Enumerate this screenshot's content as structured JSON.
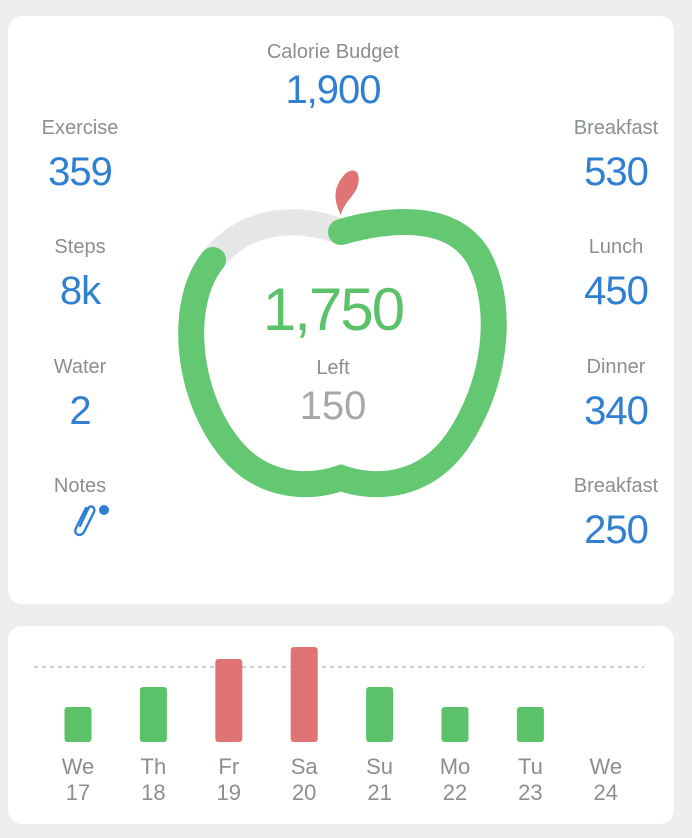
{
  "budget": {
    "label": "Calorie Budget",
    "value": "1,900"
  },
  "left_stats": [
    {
      "label": "Exercise",
      "value": "359"
    },
    {
      "label": "Steps",
      "value": "8k"
    },
    {
      "label": "Water",
      "value": "2"
    },
    {
      "label": "Notes",
      "icon": "paperclip-icon"
    }
  ],
  "right_stats": [
    {
      "label": "Breakfast",
      "value": "530"
    },
    {
      "label": "Lunch",
      "value": "450"
    },
    {
      "label": "Dinner",
      "value": "340"
    },
    {
      "label": "Breakfast",
      "value": "250"
    }
  ],
  "center": {
    "left_value": "1,750",
    "left_label": "Left",
    "secondary_value": "150"
  },
  "progress_ring": {
    "fraction_consumed": 0.85
  },
  "colors": {
    "accent_blue": "#2f7fd2",
    "green": "#5cc26a",
    "green_light": "#6ccf78",
    "red": "#e07474",
    "track_gray": "#e6e6e6",
    "label_gray": "#8a8f94"
  },
  "chart_data": {
    "type": "bar",
    "categories": [
      "We 17",
      "Th 18",
      "Fr 19",
      "Sa 20",
      "Su 21",
      "Mo 22",
      "Tu 23",
      "We 24"
    ],
    "day_names": [
      "We",
      "Th",
      "Fr",
      "Sa",
      "Su",
      "Mo",
      "Tu",
      "We"
    ],
    "day_numbers": [
      "17",
      "18",
      "19",
      "20",
      "21",
      "22",
      "23",
      "24"
    ],
    "values": [
      0.35,
      0.55,
      0.83,
      0.95,
      0.55,
      0.35,
      0.35,
      0
    ],
    "over_budget": [
      false,
      false,
      true,
      true,
      false,
      false,
      false,
      false
    ],
    "budget_line": 0.75,
    "ylim": [
      0,
      1
    ],
    "grid": false
  }
}
